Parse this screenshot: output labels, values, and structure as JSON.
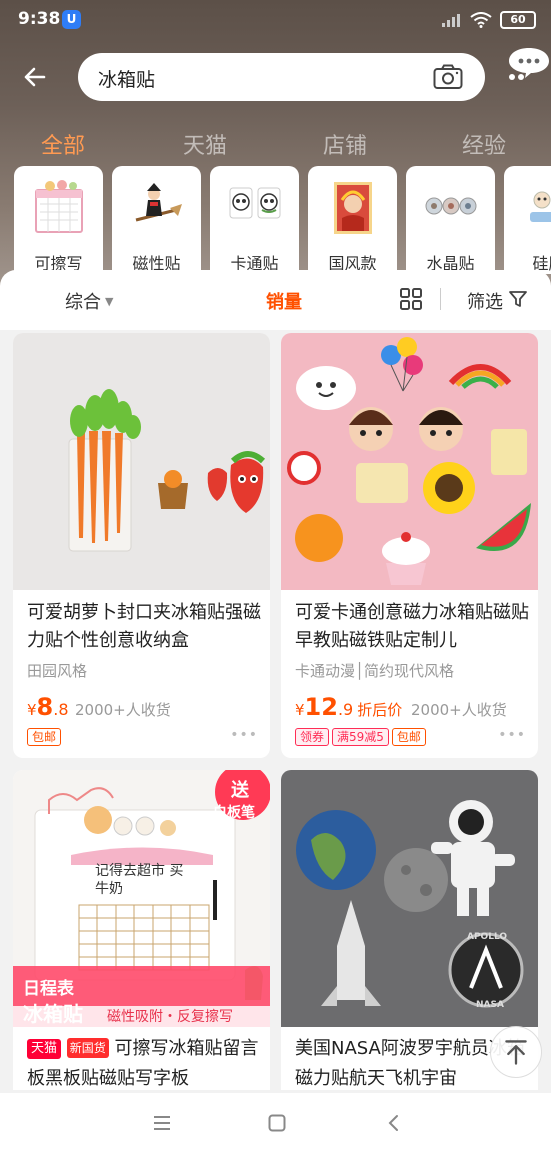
{
  "status": {
    "time": "9:38",
    "app_badge": "U",
    "battery": "60"
  },
  "search": {
    "query": "冰箱贴"
  },
  "tabs": [
    {
      "label": "全部"
    },
    {
      "label": "天猫"
    },
    {
      "label": "店铺"
    },
    {
      "label": "经验"
    }
  ],
  "categories": [
    {
      "label": "可擦写"
    },
    {
      "label": "磁性贴"
    },
    {
      "label": "卡通贴"
    },
    {
      "label": "国风款"
    },
    {
      "label": "水晶贴"
    },
    {
      "label": "硅胶"
    }
  ],
  "filter": {
    "sort": "综合",
    "sales": "销量",
    "filter": "筛选"
  },
  "products": [
    {
      "title": "可爱胡萝卜封口夹冰箱贴强磁力贴个性创意收纳盒",
      "style": "田园风格",
      "yen": "¥",
      "price_int": "8",
      "price_dec": ".8",
      "sold": "2000+人收货",
      "badge": "包邮"
    },
    {
      "title": "可爱卡通创意磁力冰箱贴磁贴早教贴磁铁贴定制儿",
      "style": "卡通动漫│简约现代风格",
      "yen": "¥",
      "price_int": "12",
      "price_dec": ".9",
      "price_tag": "折后价",
      "sold": "2000+人收货",
      "badge_coupon": "领券",
      "badge_deal": "满59减5",
      "badge": "包邮"
    },
    {
      "tmall": "天猫",
      "new": "新国货",
      "title": "可擦写冰箱贴留言板黑板贴磁贴写字板",
      "img_gift": "送",
      "img_gift2": "白板笔",
      "img_title1": "日程表",
      "img_title2": "冰箱贴",
      "img_slogan": "磁性吸附・反复擦写",
      "img_board": "记得去超市 买牛奶"
    },
    {
      "title": "美国NASA阿波罗宇航员冰箱磁力贴航天飞机宇宙",
      "img_apollo": "APOLLO",
      "img_nasa": "NASA"
    }
  ]
}
